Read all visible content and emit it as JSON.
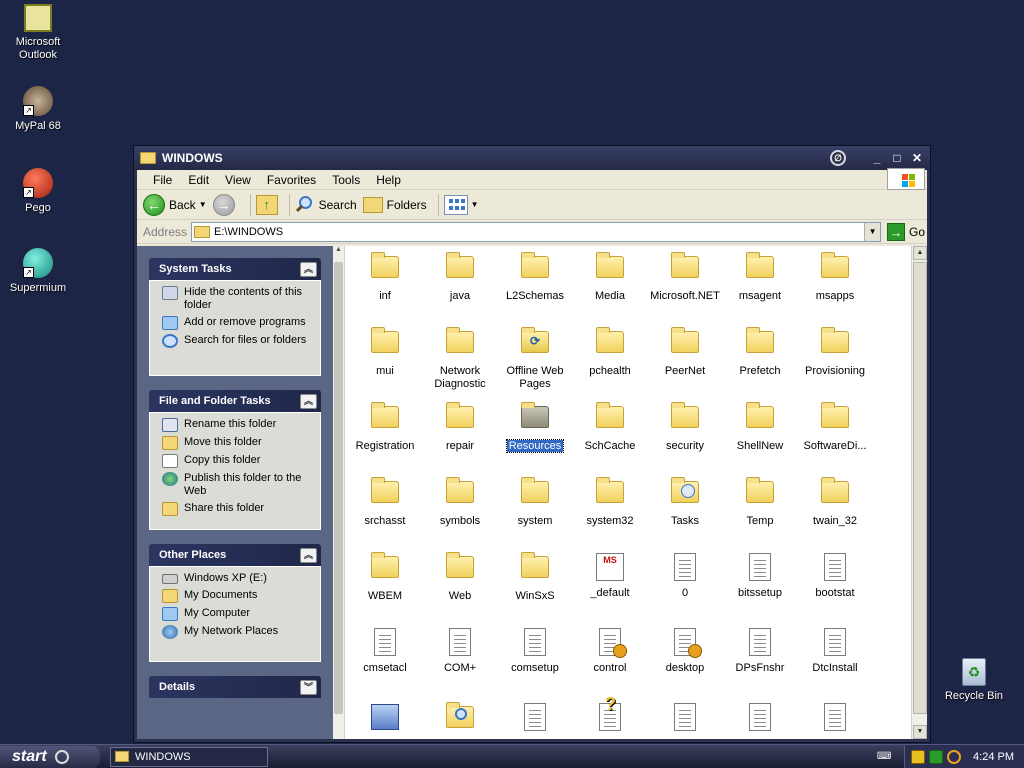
{
  "desktop": {
    "icons": [
      {
        "label": "Microsoft\nOutlook",
        "icon": "outlook-icon"
      },
      {
        "label": "MyPal 68",
        "icon": "mypal-icon"
      },
      {
        "label": "Pego",
        "icon": "pego-icon"
      },
      {
        "label": "Supermium",
        "icon": "supermium-icon"
      },
      {
        "label": "Recycle Bin",
        "icon": "recycle-bin-icon"
      }
    ]
  },
  "window": {
    "title": "WINDOWS",
    "controls": {
      "minimize": "_",
      "maximize": "□",
      "close": "✕"
    },
    "menu": [
      "File",
      "Edit",
      "View",
      "Favorites",
      "Tools",
      "Help"
    ],
    "toolbar": {
      "back": "Back",
      "search": "Search",
      "folders": "Folders"
    },
    "address": {
      "label": "Address",
      "value": "E:\\WINDOWS",
      "go": "Go"
    }
  },
  "taskpane": {
    "panels": [
      {
        "title": "System Tasks",
        "tasks": [
          {
            "label": "Hide the contents of this folder",
            "icon": "hide-contents-icon"
          },
          {
            "label": "Add or remove programs",
            "icon": "add-remove-programs-icon"
          },
          {
            "label": "Search for files or folders",
            "icon": "search-icon"
          }
        ]
      },
      {
        "title": "File and Folder Tasks",
        "tasks": [
          {
            "label": "Rename this folder",
            "icon": "rename-icon"
          },
          {
            "label": "Move this folder",
            "icon": "move-icon"
          },
          {
            "label": "Copy this folder",
            "icon": "copy-icon"
          },
          {
            "label": "Publish this folder to the Web",
            "icon": "publish-web-icon"
          },
          {
            "label": "Share this folder",
            "icon": "share-icon"
          }
        ]
      },
      {
        "title": "Other Places",
        "tasks": [
          {
            "label": "Windows XP (E:)",
            "icon": "drive-icon"
          },
          {
            "label": "My Documents",
            "icon": "my-documents-icon"
          },
          {
            "label": "My Computer",
            "icon": "my-computer-icon"
          },
          {
            "label": "My Network Places",
            "icon": "network-places-icon"
          }
        ]
      },
      {
        "title": "Details",
        "tasks": []
      }
    ]
  },
  "files": [
    {
      "name": "inf",
      "type": "folder"
    },
    {
      "name": "java",
      "type": "folder"
    },
    {
      "name": "L2Schemas",
      "type": "folder"
    },
    {
      "name": "Media",
      "type": "folder"
    },
    {
      "name": "Microsoft.NET",
      "type": "folder"
    },
    {
      "name": "msagent",
      "type": "folder"
    },
    {
      "name": "msapps",
      "type": "folder"
    },
    {
      "name": "mui",
      "type": "folder"
    },
    {
      "name": "Network Diagnostic",
      "type": "folder"
    },
    {
      "name": "Offline Web Pages",
      "type": "special-folder"
    },
    {
      "name": "pchealth",
      "type": "folder"
    },
    {
      "name": "PeerNet",
      "type": "folder"
    },
    {
      "name": "Prefetch",
      "type": "folder"
    },
    {
      "name": "Provisioning",
      "type": "folder"
    },
    {
      "name": "Registration",
      "type": "folder"
    },
    {
      "name": "repair",
      "type": "folder"
    },
    {
      "name": "Resources",
      "type": "resources-folder",
      "selected": true
    },
    {
      "name": "SchCache",
      "type": "folder"
    },
    {
      "name": "security",
      "type": "folder"
    },
    {
      "name": "ShellNew",
      "type": "folder"
    },
    {
      "name": "SoftwareDi...",
      "type": "folder"
    },
    {
      "name": "srchasst",
      "type": "folder"
    },
    {
      "name": "symbols",
      "type": "folder"
    },
    {
      "name": "system",
      "type": "folder"
    },
    {
      "name": "system32",
      "type": "folder"
    },
    {
      "name": "Tasks",
      "type": "tasks-folder"
    },
    {
      "name": "Temp",
      "type": "folder"
    },
    {
      "name": "twain_32",
      "type": "folder"
    },
    {
      "name": "WBEM",
      "type": "folder"
    },
    {
      "name": "Web",
      "type": "folder"
    },
    {
      "name": "WinSxS",
      "type": "folder"
    },
    {
      "name": "_default",
      "type": "shortcut"
    },
    {
      "name": "0",
      "type": "document"
    },
    {
      "name": "bitssetup",
      "type": "document"
    },
    {
      "name": "bootstat",
      "type": "document"
    },
    {
      "name": "cmsetacl",
      "type": "document"
    },
    {
      "name": "COM+",
      "type": "document"
    },
    {
      "name": "comsetup",
      "type": "document"
    },
    {
      "name": "control",
      "type": "config-file"
    },
    {
      "name": "desktop",
      "type": "config-file"
    },
    {
      "name": "DPsFnshr",
      "type": "document"
    },
    {
      "name": "DtcInstall",
      "type": "document"
    },
    {
      "name": "",
      "type": "exe"
    },
    {
      "name": "",
      "type": "search-file"
    },
    {
      "name": "",
      "type": "document"
    },
    {
      "name": "",
      "type": "help-file"
    },
    {
      "name": "",
      "type": "document"
    },
    {
      "name": "",
      "type": "document"
    },
    {
      "name": "",
      "type": "document"
    }
  ],
  "taskbar": {
    "start": "start",
    "active_task": "WINDOWS",
    "clock": "4:24 PM"
  }
}
